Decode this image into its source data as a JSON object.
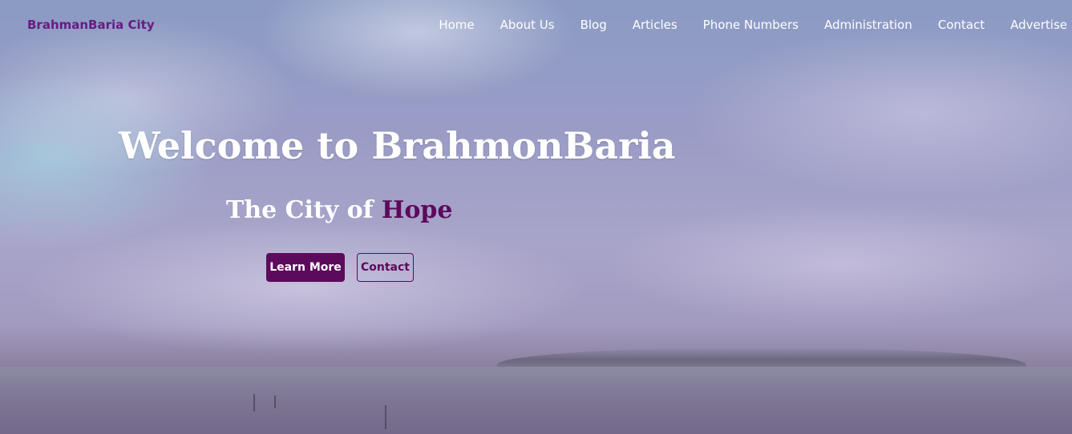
{
  "brand": "BrahmanBaria City",
  "nav": {
    "items": [
      "Home",
      "About Us",
      "Blog",
      "Articles",
      "Phone Numbers",
      "Administration",
      "Contact",
      "Advertise"
    ]
  },
  "hero": {
    "title": "Welcome to BrahmonBaria",
    "subtitle_prefix": "The City of ",
    "subtitle_accent": "Hope",
    "primary_button": "Learn More",
    "secondary_button": "Contact"
  },
  "colors": {
    "brand": "#6a1b82",
    "accent": "#5c0a5c",
    "nav_text": "#ffffff",
    "hero_text": "#ffffff"
  }
}
